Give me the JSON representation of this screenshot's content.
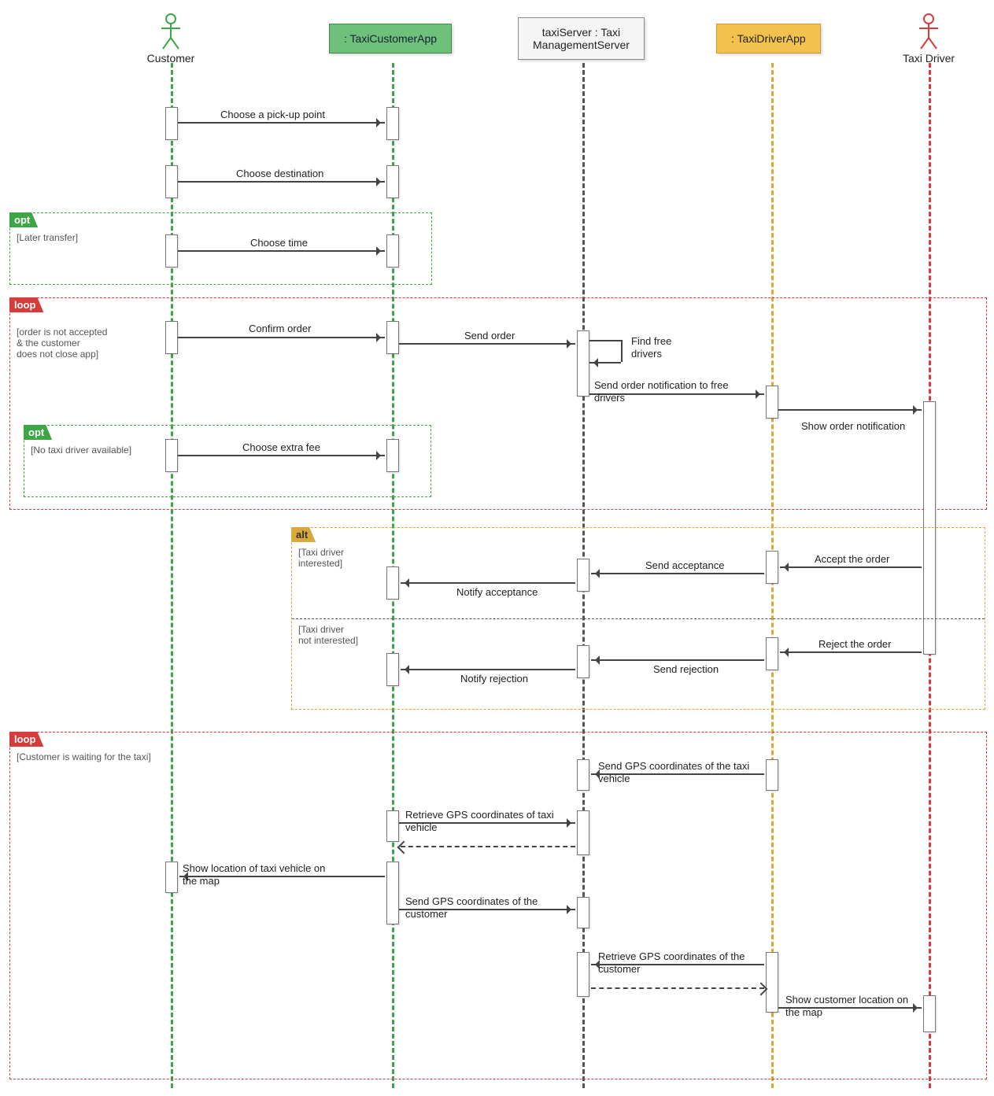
{
  "lifelines": {
    "customer": "Customer",
    "customerApp": ": TaxiCustomerApp",
    "serverLine1": "taxiServer : Taxi",
    "serverLine2": "ManagementServer",
    "driverApp": ": TaxiDriverApp",
    "driver": "Taxi Driver"
  },
  "frames": {
    "opt1": {
      "type": "opt",
      "guard": "[Later transfer]"
    },
    "loop1": {
      "type": "loop",
      "guard": "[order is not accepted\n& the customer\ndoes not close app]"
    },
    "opt2": {
      "type": "opt",
      "guard": "[No taxi driver available]"
    },
    "alt": {
      "type": "alt",
      "guard1": "[Taxi driver\ninterested]",
      "guard2": "[Taxi driver\nnot interested]"
    },
    "loop2": {
      "type": "loop",
      "guard": "[Customer is waiting for the taxi]"
    }
  },
  "messages": {
    "m1": "Choose a pick-up point",
    "m2": "Choose destination",
    "m3": "Choose time",
    "m4": "Confirm order",
    "m5": "Send order",
    "m6": "Find free drivers",
    "m7": "Send order notification to free drivers",
    "m8": "Show order notification",
    "m9": "Choose extra fee",
    "m10": "Accept the order",
    "m11": "Send acceptance",
    "m12": "Notify acceptance",
    "m13": "Reject the order",
    "m14": "Send rejection",
    "m15": "Notify rejection",
    "m16": "Send GPS coordinates of the taxi vehicle",
    "m17": "Retrieve GPS coordinates of taxi vehicle",
    "m18": "Show location of taxi vehicle on the map",
    "m19": "Send GPS coordinates of the customer",
    "m20": "Retrieve GPS coordinates of the customer",
    "m21": "Show customer location on the map"
  },
  "chart_data": {
    "type": "uml-sequence-diagram",
    "lifelines": [
      {
        "id": "customer",
        "name": "Customer",
        "kind": "actor",
        "color": "#3fa648"
      },
      {
        "id": "custApp",
        "name": ": TaxiCustomerApp",
        "kind": "object",
        "color": "#6ec07a"
      },
      {
        "id": "server",
        "name": "taxiServer : TaxiManagementServer",
        "kind": "object",
        "color": "#555"
      },
      {
        "id": "drvApp",
        "name": ": TaxiDriverApp",
        "kind": "object",
        "color": "#f2c14e"
      },
      {
        "id": "driver",
        "name": "Taxi Driver",
        "kind": "actor",
        "color": "#d63c3c"
      }
    ],
    "interactions": [
      {
        "type": "message",
        "from": "customer",
        "to": "custApp",
        "label": "Choose a pick-up point"
      },
      {
        "type": "message",
        "from": "customer",
        "to": "custApp",
        "label": "Choose destination"
      },
      {
        "type": "frame",
        "kind": "opt",
        "guard": "Later transfer",
        "children": [
          {
            "type": "message",
            "from": "customer",
            "to": "custApp",
            "label": "Choose time"
          }
        ]
      },
      {
        "type": "frame",
        "kind": "loop",
        "guard": "order is not accepted & the customer does not close app",
        "children": [
          {
            "type": "message",
            "from": "customer",
            "to": "custApp",
            "label": "Confirm order"
          },
          {
            "type": "message",
            "from": "custApp",
            "to": "server",
            "label": "Send order"
          },
          {
            "type": "self",
            "on": "server",
            "label": "Find free drivers"
          },
          {
            "type": "message",
            "from": "server",
            "to": "drvApp",
            "label": "Send order notification to free drivers"
          },
          {
            "type": "message",
            "from": "drvApp",
            "to": "driver",
            "label": "Show order notification"
          },
          {
            "type": "frame",
            "kind": "opt",
            "guard": "No taxi driver available",
            "children": [
              {
                "type": "message",
                "from": "customer",
                "to": "custApp",
                "label": "Choose extra fee"
              }
            ]
          }
        ]
      },
      {
        "type": "frame",
        "kind": "alt",
        "operands": [
          {
            "guard": "Taxi driver interested",
            "children": [
              {
                "type": "message",
                "from": "driver",
                "to": "drvApp",
                "label": "Accept the order"
              },
              {
                "type": "message",
                "from": "drvApp",
                "to": "server",
                "label": "Send acceptance"
              },
              {
                "type": "message",
                "from": "server",
                "to": "custApp",
                "label": "Notify acceptance"
              }
            ]
          },
          {
            "guard": "Taxi driver not interested",
            "children": [
              {
                "type": "message",
                "from": "driver",
                "to": "drvApp",
                "label": "Reject the order"
              },
              {
                "type": "message",
                "from": "drvApp",
                "to": "server",
                "label": "Send rejection"
              },
              {
                "type": "message",
                "from": "server",
                "to": "custApp",
                "label": "Notify rejection"
              }
            ]
          }
        ]
      },
      {
        "type": "frame",
        "kind": "loop",
        "guard": "Customer is waiting for the taxi",
        "children": [
          {
            "type": "message",
            "from": "drvApp",
            "to": "server",
            "label": "Send GPS coordinates of the taxi vehicle"
          },
          {
            "type": "message",
            "from": "custApp",
            "to": "server",
            "label": "Retrieve GPS coordinates of taxi vehicle",
            "return": true
          },
          {
            "type": "message",
            "from": "custApp",
            "to": "customer",
            "label": "Show location of taxi vehicle on the map"
          },
          {
            "type": "message",
            "from": "custApp",
            "to": "server",
            "label": "Send GPS coordinates of the customer"
          },
          {
            "type": "message",
            "from": "drvApp",
            "to": "server",
            "label": "Retrieve GPS coordinates of the customer",
            "return": true
          },
          {
            "type": "message",
            "from": "drvApp",
            "to": "driver",
            "label": "Show customer location on the map"
          }
        ]
      }
    ]
  }
}
